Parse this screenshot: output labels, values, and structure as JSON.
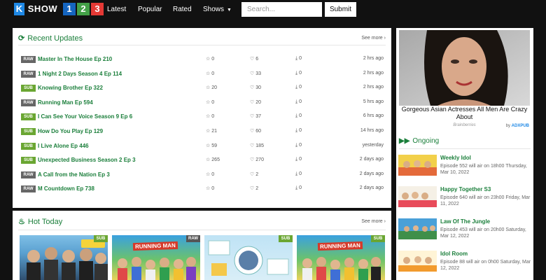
{
  "header": {
    "logo": {
      "k": "K",
      "show": "SHOW",
      "one": "1",
      "two": "2",
      "three": "3"
    },
    "nav": {
      "latest": "Latest",
      "popular": "Popular",
      "rated": "Rated",
      "shows": "Shows"
    },
    "search": {
      "placeholder": "Search...",
      "value": ""
    },
    "submit_label": "Submit"
  },
  "recent": {
    "title": "Recent Updates",
    "see_more": "See more",
    "items": [
      {
        "badge": "RAW",
        "title": "Master In The House Ep 210",
        "stars": "0",
        "likes": "6",
        "downloads": "0",
        "time": "2 hrs ago"
      },
      {
        "badge": "RAW",
        "title": "1 Night 2 Days Season 4 Ep 114",
        "stars": "0",
        "likes": "33",
        "downloads": "0",
        "time": "2 hrs ago"
      },
      {
        "badge": "SUB",
        "title": "Knowing Brother Ep 322",
        "stars": "20",
        "likes": "30",
        "downloads": "0",
        "time": "2 hrs ago"
      },
      {
        "badge": "RAW",
        "title": "Running Man Ep 594",
        "stars": "0",
        "likes": "20",
        "downloads": "0",
        "time": "5 hrs ago"
      },
      {
        "badge": "SUB",
        "title": "I Can See Your Voice Season 9 Ep 6",
        "stars": "0",
        "likes": "37",
        "downloads": "0",
        "time": "6 hrs ago"
      },
      {
        "badge": "SUB",
        "title": "How Do You Play Ep 129",
        "stars": "21",
        "likes": "60",
        "downloads": "0",
        "time": "14 hrs ago"
      },
      {
        "badge": "SUB",
        "title": "I Live Alone Ep 446",
        "stars": "59",
        "likes": "185",
        "downloads": "0",
        "time": "yesterday"
      },
      {
        "badge": "SUB",
        "title": "Unexpected Business Season 2 Ep 3",
        "stars": "265",
        "likes": "270",
        "downloads": "0",
        "time": "2 days ago"
      },
      {
        "badge": "RAW",
        "title": "A Call from the Nation Ep 3",
        "stars": "0",
        "likes": "2",
        "downloads": "0",
        "time": "2 days ago"
      },
      {
        "badge": "RAW",
        "title": "M Countdown Ep 738",
        "stars": "0",
        "likes": "2",
        "downloads": "0",
        "time": "2 days ago"
      }
    ]
  },
  "hot": {
    "title": "Hot Today",
    "see_more": "See more",
    "thumbs": [
      {
        "badge": "SUB",
        "art_text": ""
      },
      {
        "badge": "RAW",
        "art_text": "RUNNING MAN"
      },
      {
        "badge": "SUB",
        "art_text": ""
      },
      {
        "badge": "SUB",
        "art_text": "RUNNING MAN"
      }
    ]
  },
  "sidebar": {
    "ad": {
      "headline": "Gorgeous Asian Actresses All Men Are Crazy About",
      "source": "Brainberries",
      "by": "by",
      "brand": "ADXPUB"
    },
    "ongoing_title": "Ongoing",
    "ongoing": [
      {
        "name": "Weekly Idol",
        "line": "Episode 552 will air on 18h00 Thursday, Mar 10, 2022"
      },
      {
        "name": "Happy Together S3",
        "line": "Episode 640 will air on 23h00 Friday, Mar 11, 2022"
      },
      {
        "name": "Law Of The Jungle",
        "line": "Episode 453 will air on 20h00 Saturday, Mar 12, 2022"
      },
      {
        "name": "Idol Room",
        "line": "Episode 88 will air on 0h00 Saturday, Mar 12, 2022"
      }
    ]
  },
  "colors": {
    "accent_green": "#1b7f3b",
    "sub_badge": "#6aa632",
    "raw_badge": "#666666",
    "page_bg": "#111111"
  }
}
